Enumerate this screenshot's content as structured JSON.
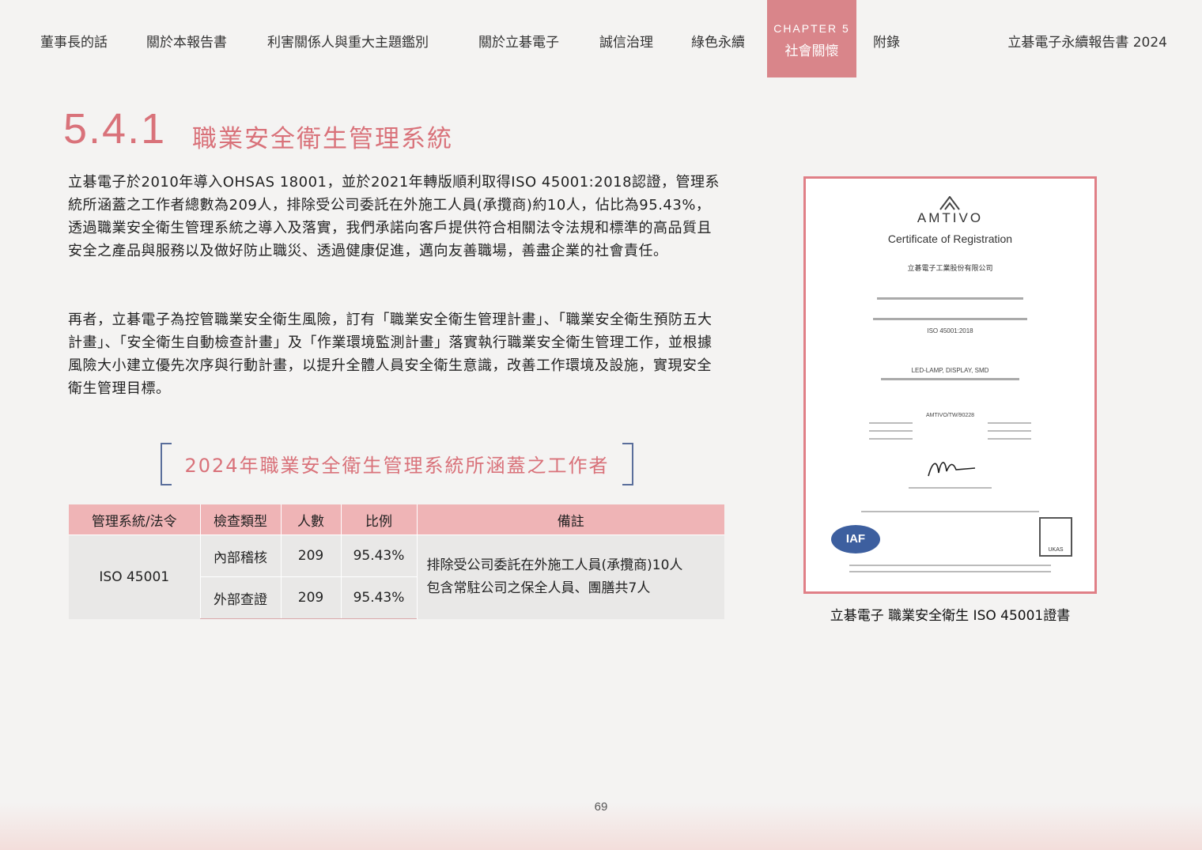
{
  "nav": {
    "items": [
      "董事長的話",
      "關於本報告書",
      "利害關係人與重大主題鑑別",
      "關於立碁電子",
      "誠信治理",
      "綠色永續"
    ],
    "active_chapter": "CHAPTER 5",
    "active_label": "社會關懷",
    "appendix": "附錄",
    "report_title": "立碁電子永續報告書 2024",
    "accent_color": "#d9858a"
  },
  "section": {
    "number": "5.4.1",
    "title": "職業安全衛生管理系統"
  },
  "paragraphs": [
    "立碁電子於2010年導入OHSAS 18001，並於2021年轉版順利取得ISO 45001:2018認證，管理系統所涵蓋之工作者總數為209人，排除受公司委託在外施工人員(承攬商)約10人，佔比為95.43%，透過職業安全衛生管理系統之導入及落實，我們承諾向客戶提供符合相關法令法規和標準的高品質且安全之產品與服務以及做好防止職災、透過健康促進，邁向友善職場，善盡企業的社會責任。",
    "再者，立碁電子為控管職業安全衛生風險，訂有「職業安全衛生管理計畫」、「職業安全衛生預防五大計畫」、「安全衛生自動檢查計畫」及「作業環境監測計畫」落實執行職業安全衛生管理工作，並根據風險大小建立優先次序與行動計畫，以提升全體人員安全衛生意識，改善工作環境及設施，實現安全衛生管理目標。"
  ],
  "table_caption": "2024年職業安全衛生管理系統所涵蓋之工作者",
  "table": {
    "headers": [
      "管理系統/法令",
      "檢查類型",
      "人數",
      "比例",
      "備註"
    ],
    "system": "ISO 45001",
    "rows": [
      {
        "type": "內部稽核",
        "count": "209",
        "ratio": "95.43%"
      },
      {
        "type": "外部查證",
        "count": "209",
        "ratio": "95.43%"
      }
    ],
    "note_line1": "排除受公司委託在外施工人員(承攬商)10人",
    "note_line2": "包含常駐公司之保全人員、團膳共7人"
  },
  "certificate": {
    "brand": "AMTIVO",
    "title": "Certificate of Registration",
    "company": "立碁電子工業股份有限公司",
    "standard": "ISO 45001:2018",
    "scope": "LED-LAMP, DISPLAY, SMD",
    "cert_no": "AMTIVO/TW/90228",
    "iaf": "IAF",
    "ukas": "UKAS",
    "caption": "立碁電子 職業安全衛生 ISO 45001證書"
  },
  "page_number": "69"
}
